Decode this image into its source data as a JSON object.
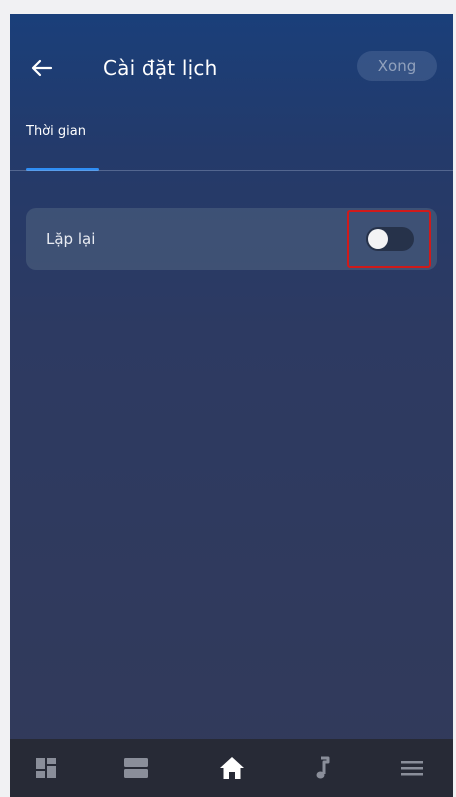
{
  "header": {
    "title": "Cài đặt lịch",
    "done_label": "Xong"
  },
  "tabs": [
    {
      "label": "Thời gian",
      "active": true
    }
  ],
  "settings": {
    "repeat_label": "Lặp lại",
    "repeat_enabled": false
  },
  "bottom_nav": {
    "items": [
      {
        "icon": "dashboard-grid-icon"
      },
      {
        "icon": "list-blocks-icon"
      },
      {
        "icon": "home-icon",
        "active": true
      },
      {
        "icon": "music-note-icon"
      },
      {
        "icon": "menu-icon"
      }
    ]
  },
  "colors": {
    "tab_indicator": "#2f8ef5",
    "highlight_box": "#d01a1a",
    "nav_active": "#ffffff",
    "nav_inactive": "#8a8e9a"
  }
}
